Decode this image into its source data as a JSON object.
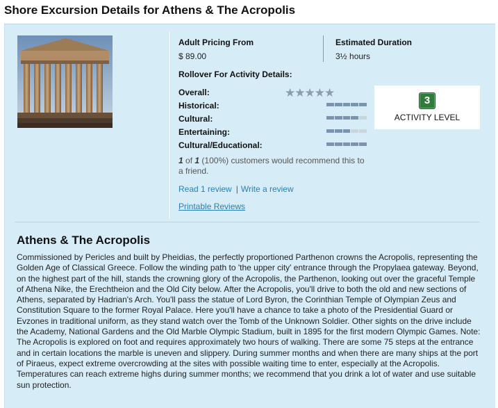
{
  "page": {
    "title": "Shore Excursion Details for Athens & The Acropolis"
  },
  "summary": {
    "pricing_label": "Adult Pricing From",
    "pricing_value": "$ 89.00",
    "duration_label": "Estimated Duration",
    "duration_value": "3½ hours",
    "rollover_label": "Rollover For Activity Details:"
  },
  "ratings": [
    {
      "label": "Overall:",
      "type": "stars",
      "value": 5,
      "max": 5
    },
    {
      "label": "Historical:",
      "type": "bar",
      "value": 5,
      "max": 5
    },
    {
      "label": "Cultural:",
      "type": "bar",
      "value": 4,
      "max": 5
    },
    {
      "label": "Entertaining:",
      "type": "bar",
      "value": 3,
      "max": 5
    },
    {
      "label": "Cultural/Educational:",
      "type": "bar",
      "value": 5,
      "max": 5
    }
  ],
  "activity": {
    "level": "3",
    "label": "ACTIVITY LEVEL"
  },
  "recommend": {
    "count": "1",
    "of": "of",
    "total": "1",
    "text": "(100%) customers would recommend this to a friend."
  },
  "reviews": {
    "read_label": "Read 1 review",
    "separator": "|",
    "write_label": "Write a review",
    "printable_label": "Printable Reviews"
  },
  "excursion": {
    "title": "Athens & The Acropolis",
    "description": "Commissioned by Pericles and built by Pheidias, the perfectly proportioned Parthenon crowns the Acropolis, representing the Golden Age of Classical Greece. Follow the winding path to 'the upper city' entrance through the Propylaea gateway. Beyond, on the highest part of the hill, stands the crowning glory of the Acropolis, the Parthenon, looking out over the graceful Temple of Athena Nike, the Erechtheion and the Old City below. After the Acropolis, you'll drive to both the old and new sections of Athens, separated by Hadrian's Arch. You'll pass the statue of Lord Byron, the Corinthian Temple of Olympian Zeus and Constitution Square to the former Royal Palace. Here you'll have a chance to take a photo of the Presidential Guard or Evzones in traditional uniform, as they stand watch over the Tomb of the Unknown Soldier. Other sights on the drive include the Academy, National Gardens and the Old Marble Olympic Stadium, built in 1895 for the first modern Olympic Games. Note: The Acropolis is explored on foot and requires approximately two hours of walking. There are some 75 steps at the entrance and in certain locations the marble is uneven and slippery. During summer months and when there are many ships at the port of Piraeus, expect extreme overcrowding at the sites with possible waiting time to enter, especially at the Acropolis. Temperatures can reach extreme highs during summer months; we recommend that you drink a lot of water and use suitable sun protection."
  },
  "colors": {
    "panel_bg": "#d6ecf6",
    "link": "#2a7fb0",
    "activity_badge": "#2f7b3b",
    "bar_on": "#7b94ad",
    "bar_off": "#c9d4dc"
  }
}
